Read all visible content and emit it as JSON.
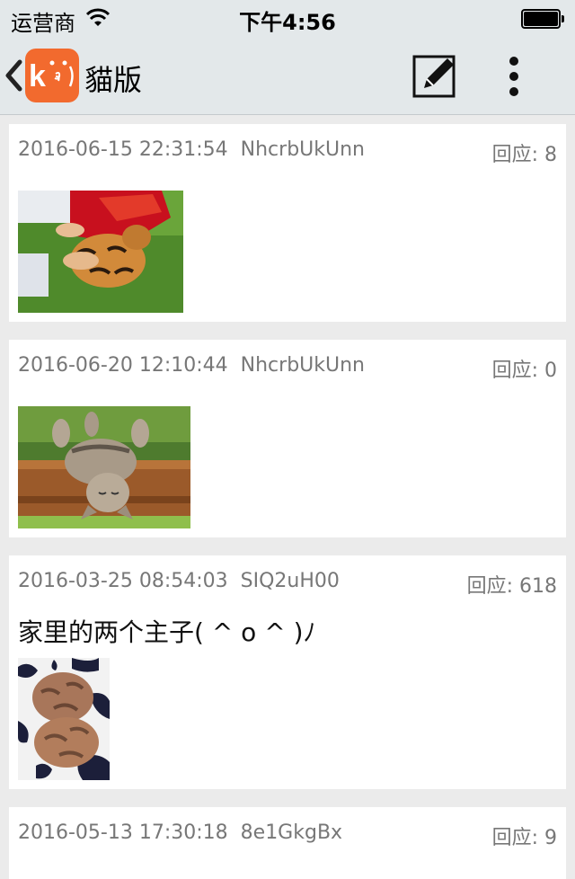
{
  "status_bar": {
    "carrier": "运营商",
    "time": "下午4:56"
  },
  "nav": {
    "title": "貓版",
    "logo_text": "k",
    "logo_color": "#f26a2e"
  },
  "posts": [
    {
      "datetime": "2016-06-15 22:31:54",
      "user": "NhcrbUkUnn",
      "replies_label": "回应: 8",
      "content": "",
      "image": "tiger-cub-on-grass"
    },
    {
      "datetime": "2016-06-20 12:10:44",
      "user": "NhcrbUkUnn",
      "replies_label": "回应: 0",
      "content": "",
      "image": "cat-sleeping-on-railing"
    },
    {
      "datetime": "2016-03-25 08:54:03",
      "user": "SIQ2uH00",
      "replies_label": "回应: 618",
      "content": "家里的两个主子( ^ o ^ )ﾉ",
      "image": "two-cats-curled-on-blanket"
    },
    {
      "datetime": "2016-05-13 17:30:18",
      "user": "8e1GkgBx",
      "replies_label": "回应: 9",
      "content": "",
      "image": ""
    }
  ]
}
